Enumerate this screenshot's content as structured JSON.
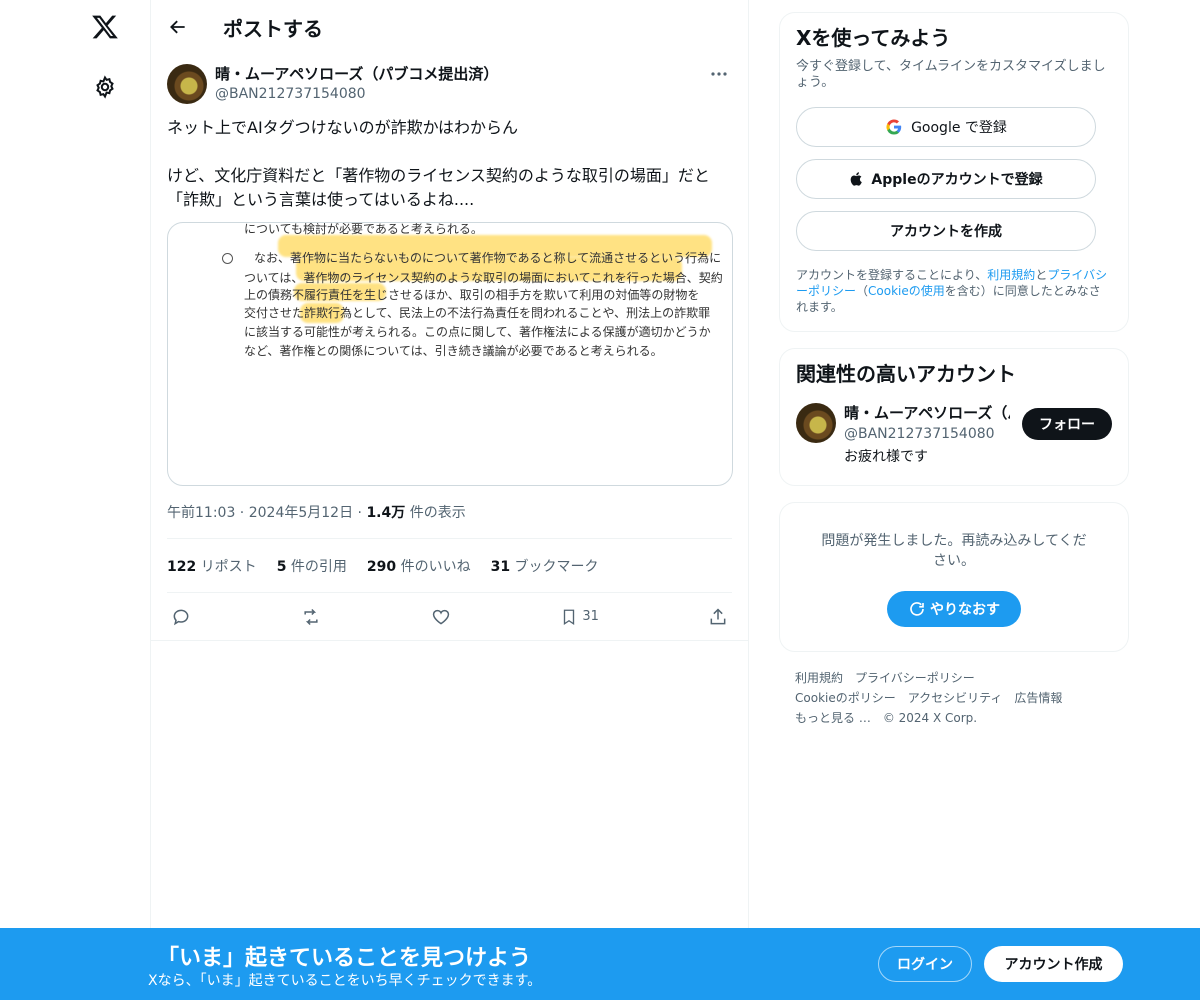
{
  "icons": {
    "logo": "x-logo-icon",
    "settings": "gear-icon",
    "back": "arrow-left-icon",
    "more": "more-icon"
  },
  "header": {
    "title": "ポストする"
  },
  "post": {
    "author_name": "晴・ムーアペソローズ（パブコメ提出済）",
    "author_handle": "@BAN212737154080",
    "text": "ネット上でAIタグつけないのが詐欺かはわからん\n\nけど、文化庁資料だと「著作物のライセンス契約のような取引の場面」だと「詐欺」という言葉は使ってはいるよね....",
    "media_lines": [
      "についても検討が必要であると考えられる。",
      "なお、著作物に当たらないものについて著作物であると称して流通させるという行為に",
      "ついては、著作物のライセンス契約のような取引の場面においてこれを行った場合、契約",
      "上の債務不履行責任を生じさせるほか、取引の相手方を欺いて利用の対価等の財物を",
      "交付させた詐欺行為として、民法上の不法行為責任を問われることや、刑法上の詐欺罪",
      "に該当する可能性が考えられる。この点に関して、著作権法による保護が適切かどうか",
      "など、著作権との関係については、引き続き議論が必要であると考えられる。"
    ],
    "time": "午前11:03",
    "date": "2024年5月12日",
    "views_count": "1.4万",
    "views_label": "件の表示",
    "stats": {
      "reposts_count": "122",
      "reposts_label": "リポスト",
      "quotes_count": "5",
      "quotes_label": "件の引用",
      "likes_count": "290",
      "likes_label": "件のいいね",
      "bookmarks_count": "31",
      "bookmarks_label": "ブックマーク"
    },
    "bookmark_action_count": "31"
  },
  "signup_card": {
    "title": "Xを使ってみよう",
    "subtitle": "今すぐ登録して、タイムラインをカスタマイズしましょう。",
    "google_label": "Google で登録",
    "apple_label": "Appleのアカウントで登録",
    "create_label": "アカウントを作成",
    "terms_pre": "アカウントを登録することにより、",
    "terms_link1": "利用規約",
    "terms_mid": "と",
    "terms_link2": "プライバシーポリシー",
    "terms_mid2": "（",
    "terms_link3": "Cookieの使用",
    "terms_post": "を含む）に同意したとみなされます。"
  },
  "relevant_card": {
    "title": "関連性の高いアカウント",
    "account_name": "晴・ムーアペソローズ（パブコメ提出済）",
    "account_handle": "@BAN212737154080",
    "account_bio": "お疲れ様です",
    "follow_label": "フォロー"
  },
  "error_card": {
    "message": "問題が発生しました。再読み込みしてください。",
    "retry_label": "やりなおす"
  },
  "footer": {
    "links": [
      "利用規約",
      "プライバシーポリシー",
      "Cookieのポリシー",
      "アクセシビリティ",
      "広告情報",
      "もっと見る …"
    ],
    "copyright": "© 2024 X Corp."
  },
  "banner": {
    "title": "「いま」起きていることを見つけよう",
    "subtitle": "Xなら、「いま」起きていることをいち早くチェックできます。",
    "login_label": "ログイン",
    "signup_label": "アカウント作成"
  },
  "colors": {
    "accent": "#1d9bf0",
    "text": "#0f1419",
    "muted": "#536471",
    "highlight": "#ffd95a"
  }
}
